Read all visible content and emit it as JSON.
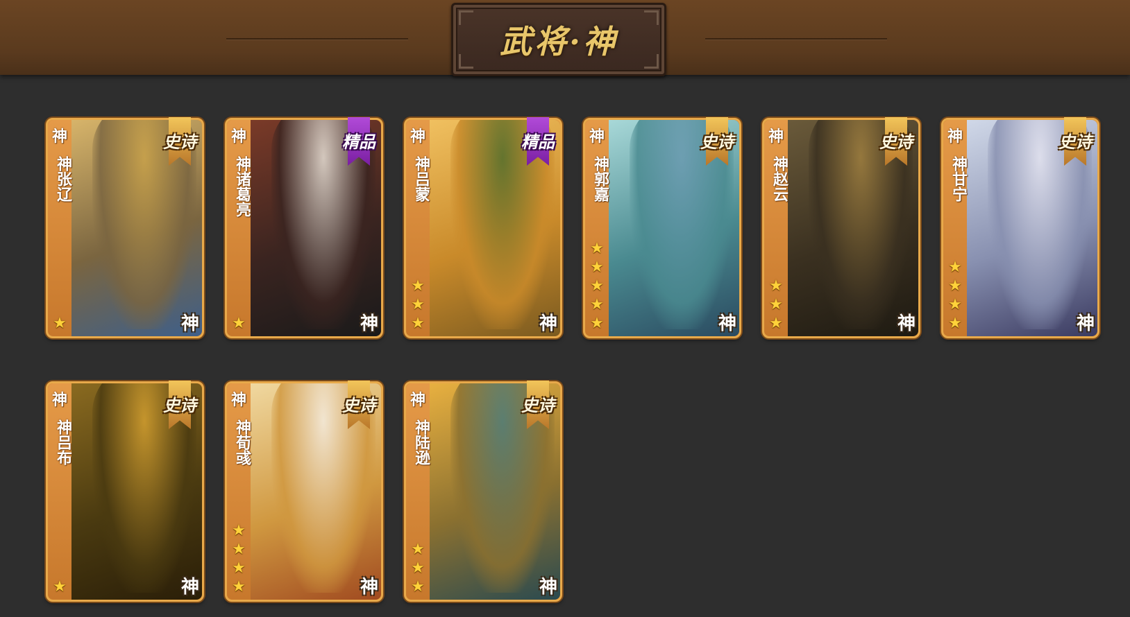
{
  "header": {
    "title": "武将·神"
  },
  "cards": [
    {
      "tier_char": "神",
      "name": "神张辽",
      "stars": 1,
      "badge": "神",
      "ribbon": "史诗",
      "ribbon_type": "epic",
      "bg": [
        "#d7b46a",
        "#7a6540",
        "#3e5f8a"
      ],
      "fig": "#c9a24a"
    },
    {
      "tier_char": "神",
      "name": "神诸葛亮",
      "stars": 1,
      "badge": "神",
      "ribbon": "精品",
      "ribbon_type": "elite",
      "bg": [
        "#7a3a28",
        "#3a2420",
        "#1a1a1a"
      ],
      "fig": "#e8e2d8"
    },
    {
      "tier_char": "神",
      "name": "神吕蒙",
      "stars": 3,
      "badge": "神",
      "ribbon": "精品",
      "ribbon_type": "elite",
      "bg": [
        "#f0c060",
        "#c98a2a",
        "#7a5a20"
      ],
      "fig": "#4e6b2a"
    },
    {
      "tier_char": "神",
      "name": "神郭嘉",
      "stars": 5,
      "badge": "神",
      "ribbon": "史诗",
      "ribbon_type": "epic",
      "bg": [
        "#a8d8d8",
        "#4a8a90",
        "#2a4a60"
      ],
      "fig": "#6a9ab0"
    },
    {
      "tier_char": "神",
      "name": "神赵云",
      "stars": 3,
      "badge": "神",
      "ribbon": "史诗",
      "ribbon_type": "epic",
      "bg": [
        "#6a5a3a",
        "#3a3020",
        "#1e1a12"
      ],
      "fig": "#a08040"
    },
    {
      "tier_char": "神",
      "name": "神甘宁",
      "stars": 4,
      "badge": "神",
      "ribbon": "史诗",
      "ribbon_type": "epic",
      "bg": [
        "#d0d8e8",
        "#8890b0",
        "#3a3a60"
      ],
      "fig": "#e4e4f0"
    },
    {
      "tier_char": "神",
      "name": "神吕布",
      "stars": 1,
      "badge": "神",
      "ribbon": "史诗",
      "ribbon_type": "epic",
      "bg": [
        "#8a6a20",
        "#4a3a10",
        "#2a1e08"
      ],
      "fig": "#d4a030"
    },
    {
      "tier_char": "神",
      "name": "神荀彧",
      "stars": 4,
      "badge": "神",
      "ribbon": "史诗",
      "ribbon_type": "epic",
      "bg": [
        "#f0d8a0",
        "#d09840",
        "#a04a20"
      ],
      "fig": "#f4ece0"
    },
    {
      "tier_char": "神",
      "name": "神陆逊",
      "stars": 3,
      "badge": "神",
      "ribbon": "史诗",
      "ribbon_type": "epic",
      "bg": [
        "#e8b040",
        "#8a7030",
        "#2a4a50"
      ],
      "fig": "#4a7a7a"
    }
  ]
}
